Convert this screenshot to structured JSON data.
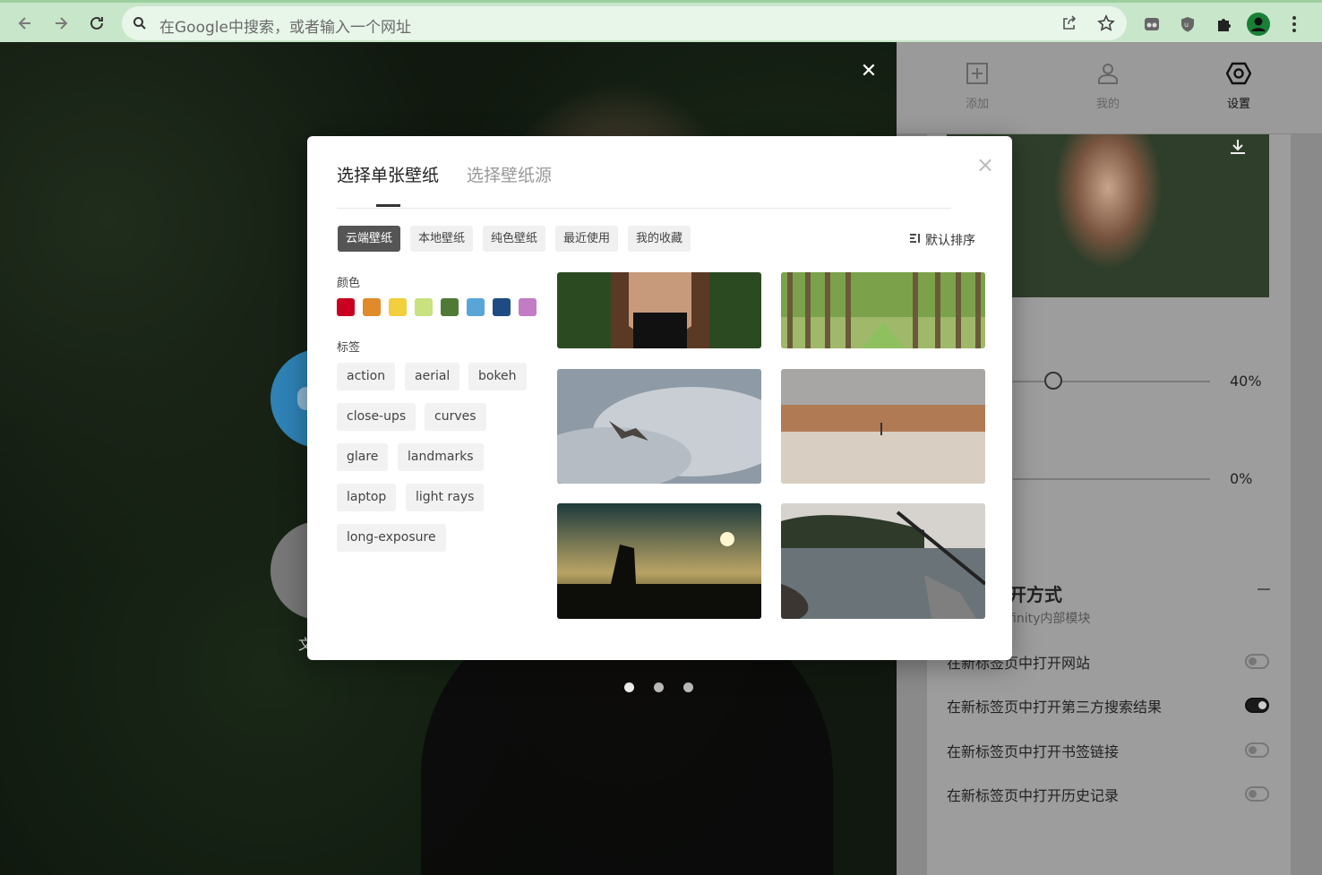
{
  "browser": {
    "address_placeholder": "在Google中搜索，或者输入一个网址"
  },
  "panel": {
    "tabs": [
      {
        "label": "添加",
        "icon": "plus-square-icon"
      },
      {
        "label": "我的",
        "icon": "user-icon"
      },
      {
        "label": "设置",
        "icon": "settings-hexagon-icon"
      }
    ],
    "slider1_value": "40%",
    "slider2_value": "0%",
    "section_title": "打开方式",
    "section_title_visible": "开方式",
    "section_subtitle": "finity内部模块",
    "options": [
      {
        "label": "在新标签页中打开网站",
        "on": false
      },
      {
        "label": "在新标签页中打开第三方搜索结果",
        "on": true
      },
      {
        "label": "在新标签页中打开书签链接",
        "on": false
      },
      {
        "label": "在新标签页中打开历史记录",
        "on": false
      }
    ]
  },
  "background": {
    "bubble_label": "文",
    "page_dots": 3,
    "active_dot": 0
  },
  "modal": {
    "tabs": [
      "选择单张壁纸",
      "选择壁纸源"
    ],
    "categories": [
      "云端壁纸",
      "本地壁纸",
      "纯色壁纸",
      "最近使用",
      "我的收藏"
    ],
    "active_category": "云端壁纸",
    "sort_label": "默认排序",
    "color_label": "颜色",
    "colors": [
      "#c9001f",
      "#e08a2c",
      "#f2cf3d",
      "#c9e17f",
      "#4e7a36",
      "#5aa5d8",
      "#1d4c84",
      "#c27cc3"
    ],
    "tag_label": "标签",
    "tags": [
      "action",
      "aerial",
      "bokeh",
      "close-ups",
      "curves",
      "glare",
      "landmarks",
      "laptop",
      "light rays",
      "long-exposure"
    ],
    "wallpapers": [
      {
        "name": "woman-portrait"
      },
      {
        "name": "tree-avenue"
      },
      {
        "name": "seagull-clouds"
      },
      {
        "name": "desert-dunes"
      },
      {
        "name": "sunset-silhouette"
      },
      {
        "name": "fishing-rod-lake"
      }
    ]
  }
}
